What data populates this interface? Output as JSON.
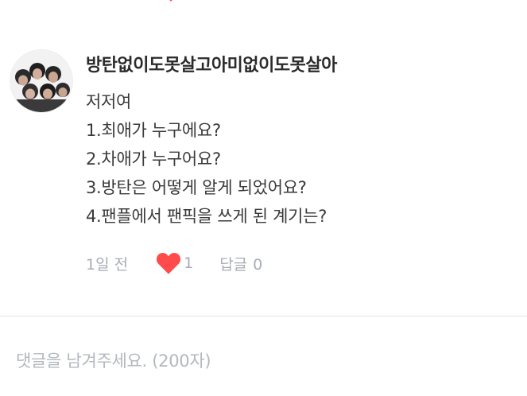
{
  "comment": {
    "author": "방탄없이도못살고아미없이도못살아",
    "lines": [
      "저저여",
      "1.최애가 누구에요?",
      "2.차애가 누구어요?",
      "3.방탄은 어떻게 알게 되었어요?",
      "4.팬플에서 팬픽을 쓰게 된 계기는?"
    ],
    "time": "1일 전",
    "like_icon": "heart-icon",
    "like_count": "1",
    "reply_label": "답글",
    "reply_count": "0"
  },
  "input": {
    "placeholder": "댓글을 남겨주세요. (200자)"
  },
  "colors": {
    "heart": "#ff4b4b",
    "meta_text": "#a7adb5",
    "divider": "#e3e3e3"
  }
}
